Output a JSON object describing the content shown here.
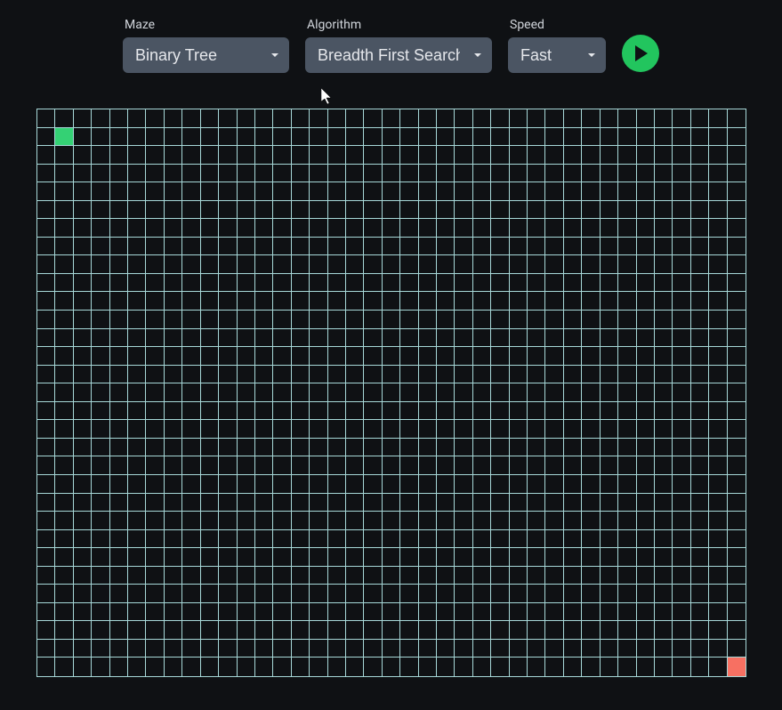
{
  "controls": {
    "maze": {
      "label": "Maze",
      "selected": "Binary Tree"
    },
    "algorithm": {
      "label": "Algorithm",
      "selected": "Breadth First Search"
    },
    "speed": {
      "label": "Speed",
      "selected": "Fast"
    }
  },
  "grid": {
    "cols": 39,
    "rows": 31,
    "start": {
      "row": 1,
      "col": 1
    },
    "end": {
      "row": 30,
      "col": 38
    }
  },
  "colors": {
    "background": "#0f1114",
    "gridLine": "#a7d8d8",
    "selectBg": "#4b5563",
    "playBtn": "#22c55e",
    "start": "#34d174",
    "end": "#f77062"
  }
}
